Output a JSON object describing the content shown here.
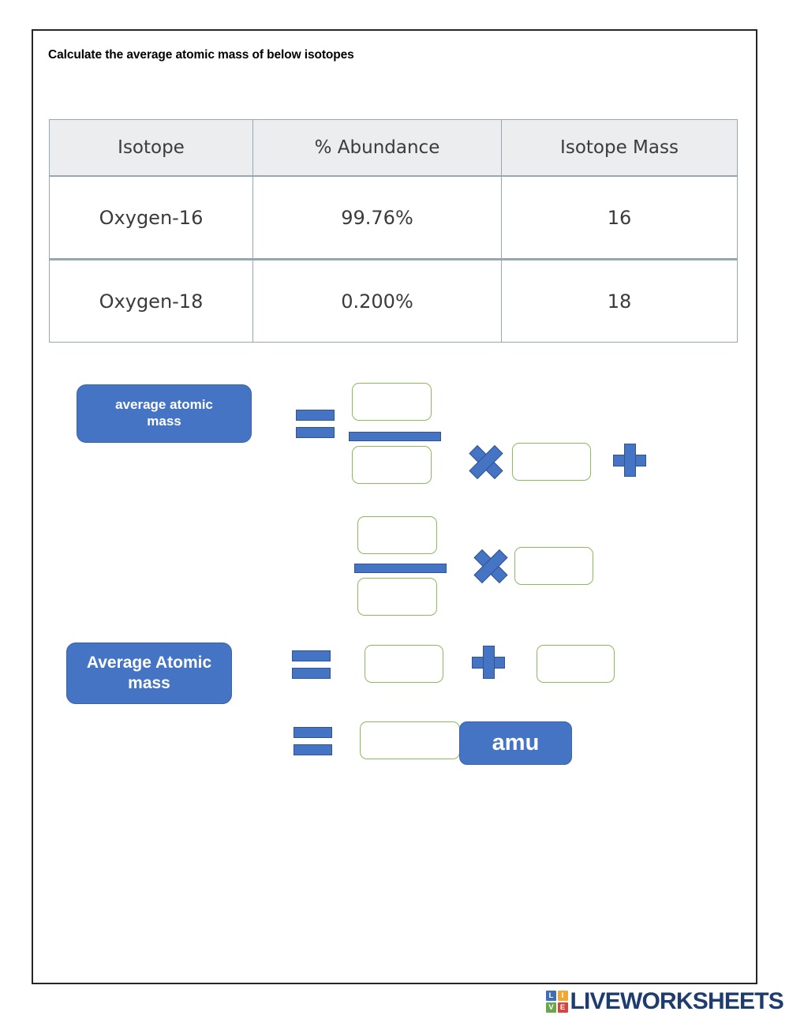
{
  "page": {
    "instruction": "Calculate the average atomic mass of below isotopes"
  },
  "table": {
    "headers": [
      "Isotope",
      "% Abundance",
      "Isotope Mass"
    ],
    "rows": [
      [
        "Oxygen-16",
        "99.76%",
        "16"
      ],
      [
        "Oxygen-18",
        "0.200%",
        "18"
      ]
    ]
  },
  "formula": {
    "label_line1": "average atomic\nmass",
    "label_line2": "Average Atomic\nmass",
    "unit_label": "amu",
    "equals_symbol": "=",
    "multiply_symbol": "✕",
    "plus_symbol": "+",
    "inputs": {
      "r1_numerator": "",
      "r1_denominator": "",
      "r1_factor": "",
      "r2_numerator": "",
      "r2_denominator": "",
      "r2_factor": "",
      "r3_term1": "",
      "r3_term2": "",
      "r4_result": ""
    },
    "input_placeholder": ""
  },
  "footer": {
    "logo_tiles": [
      "LI",
      "VE"
    ],
    "logo_letters": [
      "L",
      "I",
      "V",
      "E"
    ],
    "wordmark": "LIVEWORKSHEETS"
  },
  "colors": {
    "accent_blue": "#4574c4",
    "input_green": "#8cba5e",
    "table_border": "#93a7b4",
    "table_header_bg": "#ecedee",
    "logo_navy": "#1f3c6e"
  }
}
